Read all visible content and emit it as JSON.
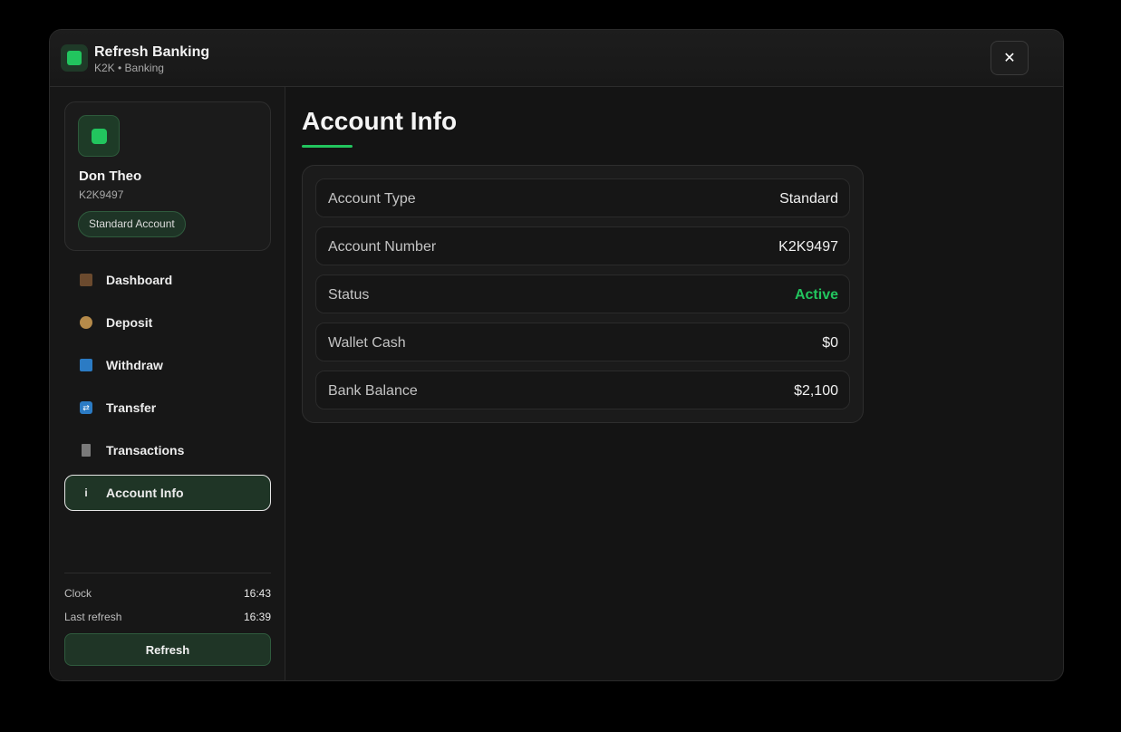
{
  "app": {
    "title": "Refresh Banking",
    "subtitle": "K2K • Banking",
    "close_label": "✕"
  },
  "profile": {
    "name": "Don Theo",
    "id": "K2K9497",
    "badge": "Standard Account"
  },
  "nav": [
    {
      "label": "Dashboard",
      "icon": "house-icon",
      "active": false
    },
    {
      "label": "Deposit",
      "icon": "money-bag-icon",
      "active": false
    },
    {
      "label": "Withdraw",
      "icon": "atm-icon",
      "active": false
    },
    {
      "label": "Transfer",
      "icon": "transfer-icon",
      "active": false
    },
    {
      "label": "Transactions",
      "icon": "receipt-icon",
      "active": false
    },
    {
      "label": "Account Info",
      "icon": "info-icon",
      "active": true
    }
  ],
  "footer": {
    "clock_label": "Clock",
    "clock_value": "16:43",
    "last_refresh_label": "Last refresh",
    "last_refresh_value": "16:39",
    "refresh_label": "Refresh"
  },
  "main": {
    "title": "Account Info",
    "rows": [
      {
        "label": "Account Type",
        "value": "Standard"
      },
      {
        "label": "Account Number",
        "value": "K2K9497"
      },
      {
        "label": "Status",
        "value": "Active"
      },
      {
        "label": "Wallet Cash",
        "value": "$0"
      },
      {
        "label": "Bank Balance",
        "value": "$2,100"
      }
    ]
  },
  "colors": {
    "accent": "#22c55e",
    "background": "#141414",
    "active_bg": "#1f3526"
  }
}
